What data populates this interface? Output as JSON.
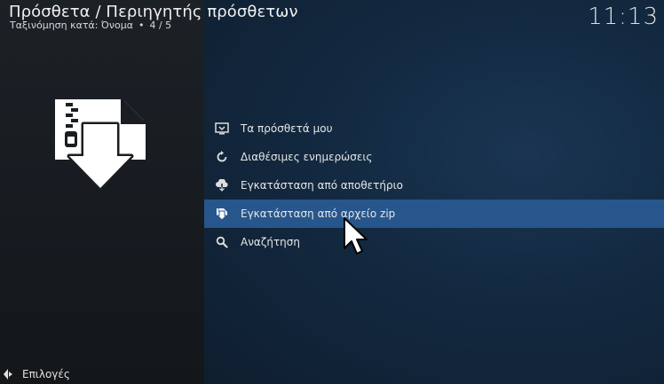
{
  "header": {
    "title": "Πρόσθετα / Περιηγητής πρόσθετων",
    "sort_label": "Ταξινόμηση κατά: Όνομα",
    "separator": "•",
    "position": "4 / 5",
    "clock": "11:13"
  },
  "preview": {
    "icon": "zip-install-icon"
  },
  "menu": {
    "items": [
      {
        "label": "Τα πρόσθετά μου",
        "icon": "my-addons-icon"
      },
      {
        "label": "Διαθέσιμες ενημερώσεις",
        "icon": "refresh-icon"
      },
      {
        "label": "Εγκατάσταση από αποθετήριο",
        "icon": "cloud-download-icon"
      },
      {
        "label": "Εγκατάσταση από αρχείο zip",
        "icon": "zip-file-icon",
        "selected": true
      },
      {
        "label": "Αναζήτηση",
        "icon": "search-icon"
      }
    ]
  },
  "footer": {
    "options_label": "Επιλογές",
    "icon": "options-arrows-icon"
  },
  "colors": {
    "selection": "#27568c",
    "background_right": "#132a42",
    "background_left": "#1a1e23"
  }
}
